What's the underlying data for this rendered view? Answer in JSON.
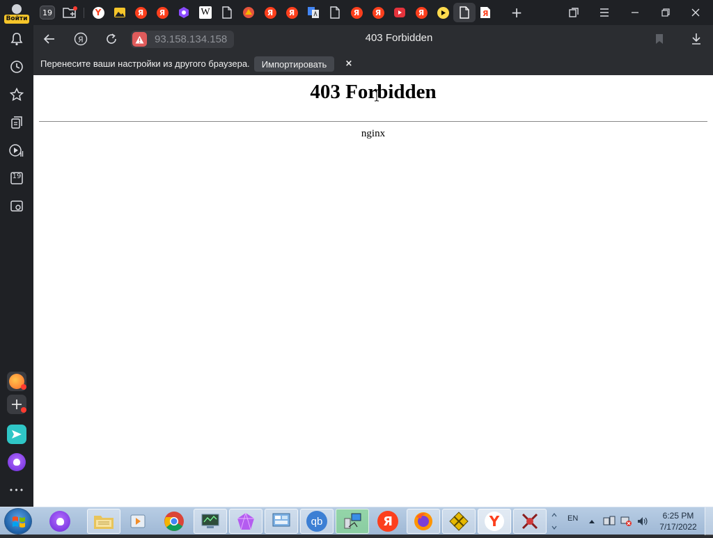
{
  "profile": {
    "login_label": "Войти"
  },
  "tabstrip": {
    "counter_badge": "19",
    "yandex_letter": "Я",
    "wiki_letter": "W",
    "new_tab_symbol": "+"
  },
  "addressbar": {
    "url": "93.158.134.158",
    "page_title": "403 Forbidden"
  },
  "infobar": {
    "message": "Перенесите ваши настройки из другого браузера.",
    "import_label": "Импортировать",
    "close_symbol": "×"
  },
  "page": {
    "heading": "403 Forbidden",
    "server": "nginx"
  },
  "sidebar": {
    "calendar_day": "19",
    "more_symbol": "•••"
  },
  "taskbar": {
    "language": "EN",
    "time": "6:25 PM",
    "date": "7/17/2022"
  },
  "colors": {
    "yandex_red": "#fc3f1d",
    "warning_red": "#e05b5b",
    "accent_yellow": "#f6c52a"
  }
}
